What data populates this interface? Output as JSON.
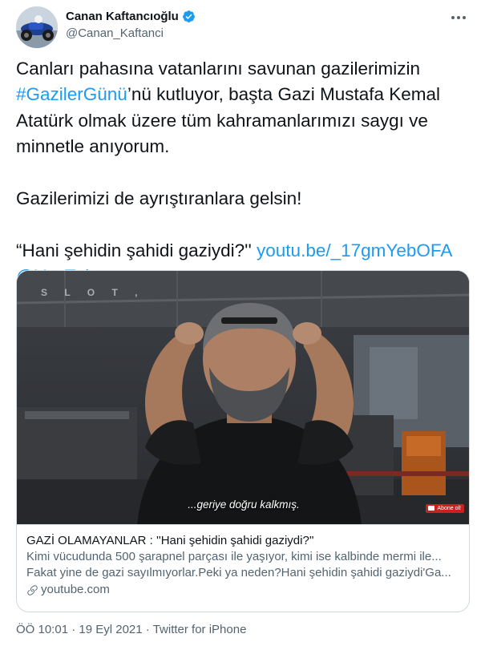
{
  "author": {
    "name": "Canan Kaftancıoğlu",
    "handle": "@Canan_Kaftanci",
    "verified_icon": "verified-badge",
    "avatar_desc": "motorcycle photo"
  },
  "tweet": {
    "line1": "Canları pahasına vatanlarını savunan gazilerimizin",
    "hashtag": "#GazilerGünü",
    "line2_rest": "’nü kutluyor, başta Gazi Mustafa Kemal",
    "line3": "Atatürk olmak üzere tüm kahramanlarımızı saygı ve",
    "line4": "minnetle anıyorum.",
    "para2": "Gazilerimizi de ayrıştıranlara gelsin!",
    "quote": "“Hani şehidin şahidi gaziydi?''",
    "youtube_link": "youtu.be/_17gmYebOFA",
    "mention": "@YouTube"
  },
  "card": {
    "video_logo": "S L O T ,",
    "subtitle": "...geriye doğru kalkmış.",
    "subscribe_badge": "Abone ol!",
    "title": "GAZİ OLAMAYANLAR : ''Hani şehidin şahidi gaziydi?''",
    "desc_line1": "Kimi vücudunda 500 şarapnel parçası ile yaşıyor, kimi ise kalbinde mermi ile...",
    "desc_line2": "Fakat yine de gazi sayılmıyorlar.Peki ya neden?Hani şehidin şahidi gaziydi'Ga...",
    "domain": "youtube.com"
  },
  "meta": {
    "time": "ÖÖ 10:01",
    "separator": " · ",
    "date": "19 Eyl 2021",
    "source": "Twitter for iPhone"
  },
  "colors": {
    "link": "#1d9bf0",
    "text": "#0f1419",
    "secondary": "#536471",
    "border": "#cfd9de"
  }
}
